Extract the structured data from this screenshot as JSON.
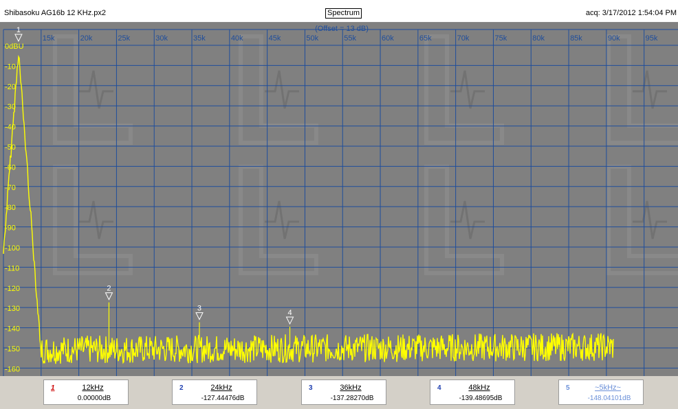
{
  "window": {
    "title": "Shibasoku AG16b 12 KHz.px2",
    "view_button": "Spectrum",
    "acquired": "acq: 3/17/2012 1:54:04 PM"
  },
  "plot": {
    "offset_label": "(Offset = 13 dB)",
    "x_tick_labels": [
      "15k",
      "20k",
      "25k",
      "30k",
      "35k",
      "40k",
      "45k",
      "50k",
      "55k",
      "60k",
      "65k",
      "70k",
      "75k",
      "80k",
      "85k",
      "90k",
      "95k"
    ],
    "y_tick_labels": [
      "0dBU",
      "-10",
      "-20",
      "-30",
      "-40",
      "-50",
      "-60",
      "-70",
      "-80",
      "-90",
      "-100",
      "-110",
      "-120",
      "-130",
      "-140",
      "-150",
      "-160"
    ],
    "x_range": [
      10000,
      99500
    ],
    "y_range": [
      -166,
      0
    ],
    "colors": {
      "background": "#808080",
      "grid": "#1e4d9c",
      "trace": "#ffff00",
      "axis_label": "#ffff00",
      "marker_label": "#ffffff"
    }
  },
  "chart_data": {
    "type": "line",
    "x_unit": "Hz",
    "y_unit": "dB",
    "noise_floor_db": -150,
    "trace_end_hz": 91000,
    "peaks": [
      {
        "freq_hz": 12000,
        "level_db": 0.0
      },
      {
        "freq_hz": 24000,
        "level_db": -127.44476
      },
      {
        "freq_hz": 36000,
        "level_db": -137.2827
      },
      {
        "freq_hz": 48000,
        "level_db": -139.48695
      }
    ],
    "markers": [
      {
        "id": "1",
        "freq_hz": 12000,
        "level_db": 0.0
      },
      {
        "id": "2",
        "freq_hz": 24000,
        "level_db": -127.44476
      },
      {
        "id": "3",
        "freq_hz": 36000,
        "level_db": -137.2827
      },
      {
        "id": "4",
        "freq_hz": 48000,
        "level_db": -139.48695
      }
    ]
  },
  "marker_table": [
    {
      "num": "1",
      "freq": "12kHz",
      "level": "0.00000dB"
    },
    {
      "num": "2",
      "freq": "24kHz",
      "level": "-127.44476dB"
    },
    {
      "num": "3",
      "freq": "36kHz",
      "level": "-137.28270dB"
    },
    {
      "num": "4",
      "freq": "48kHz",
      "level": "-139.48695dB"
    },
    {
      "num": "5",
      "freq": "~5kHz~",
      "level": "-148.04101dB"
    }
  ]
}
